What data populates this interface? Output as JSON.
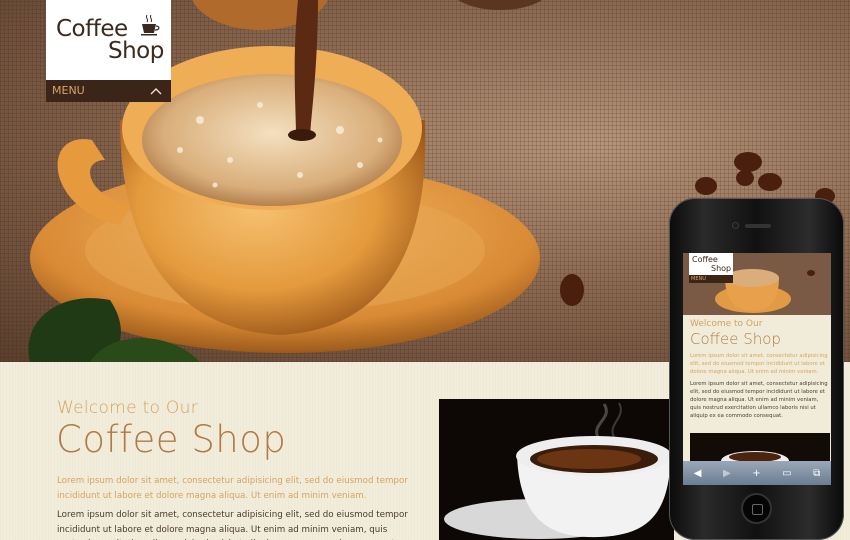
{
  "logo": {
    "line1": "Coffee",
    "line2": "Shop"
  },
  "menu": {
    "label": "MENU"
  },
  "intro": {
    "welcome": "Welcome to Our",
    "title": "Coffee Shop",
    "lead": "Lorem ipsum dolor sit amet, consectetur adipisicing elit, sed do eiusmod tempor incididunt ut labore et dolore magna aliqua. Ut enim ad minim veniam.",
    "body": "Lorem ipsum dolor sit amet, consectetur adipisicing elit, sed do eiusmod tempor incididunt ut labore et dolore magna aliqua. Ut enim ad minim veniam, quis nostrud exercitation ullamco laboris nisi ut aliquip ex ea commodo consequat. Duis aute irure dolor in reprehenderit in voluptate velit"
  },
  "phone": {
    "logo_line1": "Coffee",
    "logo_line2": "Shop",
    "menu_label": "MENU",
    "welcome": "Welcome to Our",
    "title": "Coffee Shop",
    "lead": "Lorem ipsum dolor sit amet, consectetur adipisicing elit, sed do eiusmod tempor incididunt ut labore et dolore magna aliqua. Ut enim ad minim veniam.",
    "body": "Lorem ipsum dolor sit amet, consectetur adipisicing elit, sed do eiusmod tempor incididunt ut labore et dolore magna aliqua. Ut enim ad minim veniam, quis nostrud exercitation ullamco laboris nisi ut aliquip ex ea commodo consequat."
  },
  "colors": {
    "accent": "#b07a45",
    "accent_light": "#d4a15e",
    "menu_bg": "#3a2518",
    "page_bg": "#f1ecd9"
  },
  "icons": {
    "logo": "coffee-cup-icon",
    "menu": "chevron-up-icon"
  }
}
